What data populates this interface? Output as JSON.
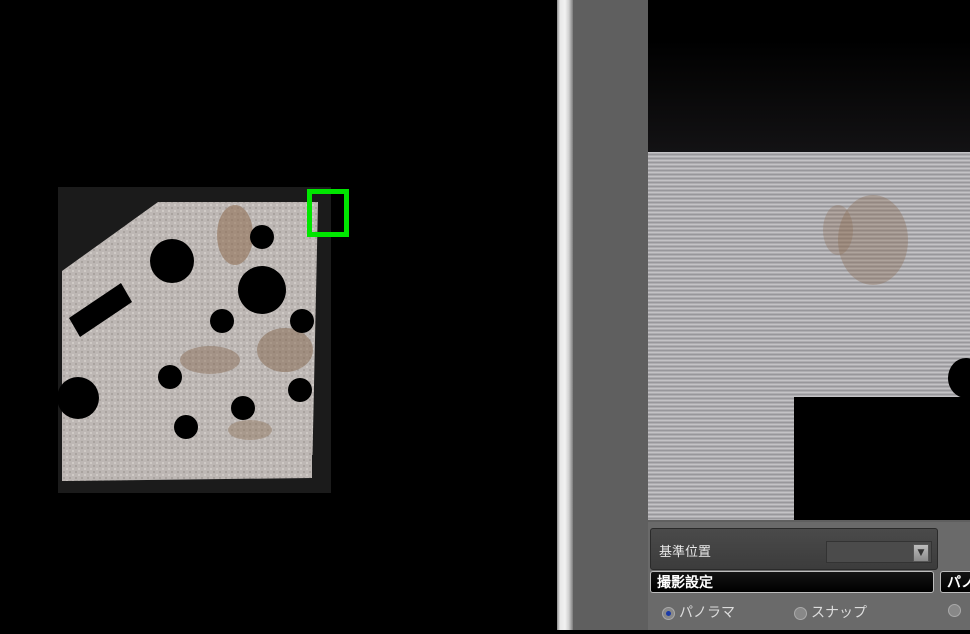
{
  "settings": {
    "reference_position_label": "基準位置",
    "shooting_settings_header": "撮影設定",
    "right_header_partial": "パノ",
    "mode_options": [
      "パノラマ",
      "スナップ"
    ],
    "selected_mode": "パノラマ"
  },
  "colors": {
    "selection_box": "#00e600",
    "background": "#000000",
    "panel": "#5f5f5f"
  }
}
